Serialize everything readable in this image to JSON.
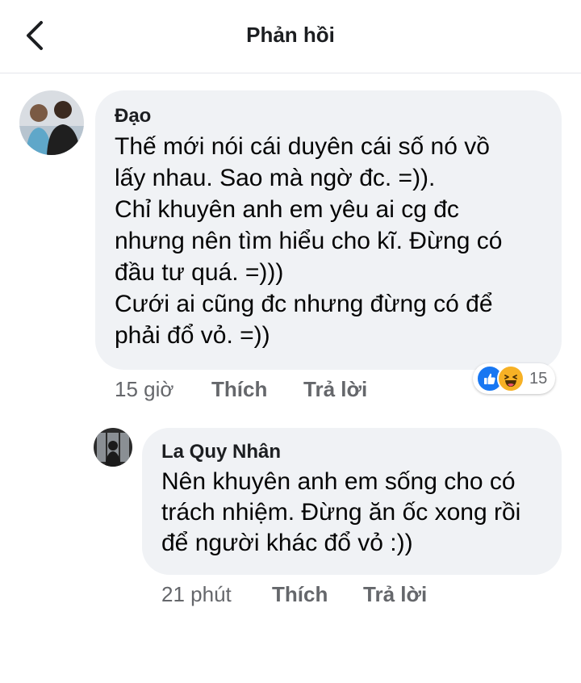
{
  "header": {
    "title": "Phản hồi"
  },
  "comments": [
    {
      "author": "Đạo",
      "text": "Thế mới nói cái duyên cái số nó vồ\nlấy nhau. Sao mà ngờ đc. =)).\nChỉ khuyên anh em yêu ai cg đc\nnhưng nên tìm hiểu cho kĩ. Đừng có\nđầu tư quá. =)))\nCưới ai cũng đc nhưng đừng có để\nphải đổ vỏ. =))",
      "time": "15 giờ",
      "like_label": "Thích",
      "reply_label": "Trả lời",
      "reaction_count": "15",
      "reaction_icons": [
        "like-icon",
        "haha-icon"
      ]
    },
    {
      "author": "La Quy Nhân",
      "text": "Nên khuyên anh em sống cho có\ntrách nhiệm. Đừng ăn ốc xong rồi\nđể người khác đổ vỏ :))",
      "time": "21 phút",
      "like_label": "Thích",
      "reply_label": "Trả lời"
    }
  ],
  "colors": {
    "like_blue": "#1877f2",
    "haha_yellow": "#f7b125",
    "bubble_bg": "#f0f2f5",
    "meta_gray": "#65676b"
  }
}
